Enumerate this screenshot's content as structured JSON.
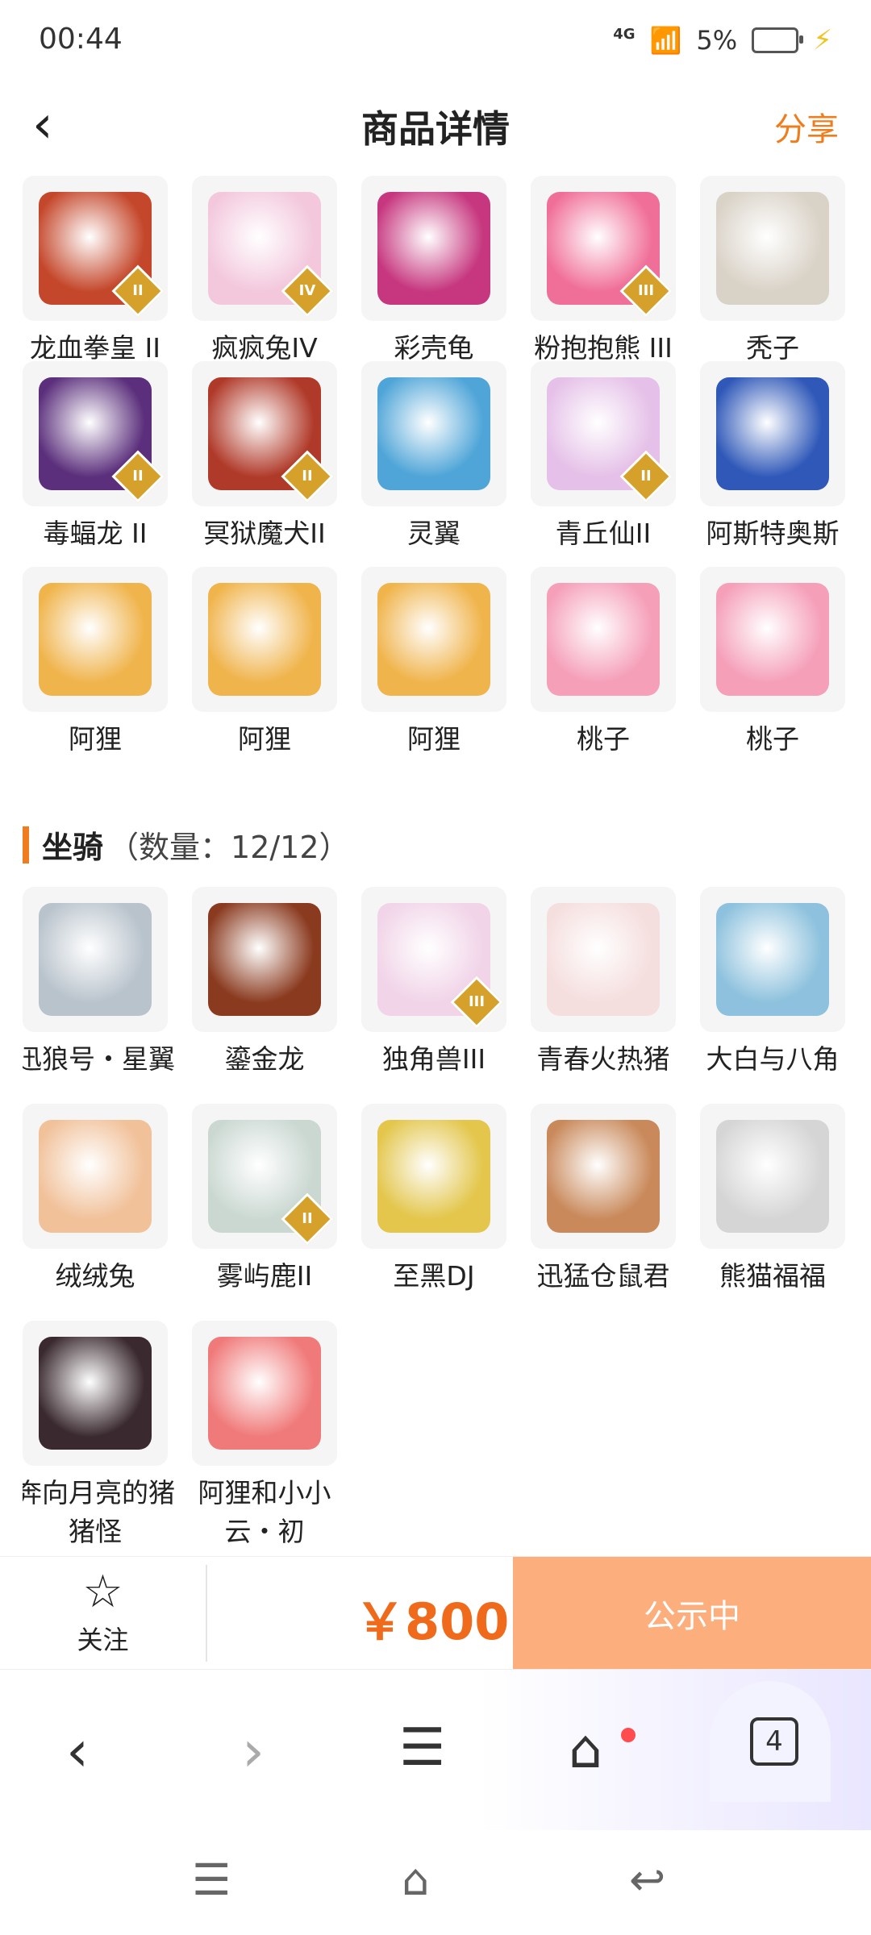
{
  "status": {
    "time": "00:44",
    "signal": "4G",
    "battery": "5%"
  },
  "header": {
    "title": "商品详情",
    "share": "分享"
  },
  "row_top": [
    {
      "label": "龙血拳皇 II",
      "color": "#c4472b",
      "badge": "II"
    },
    {
      "label": "疯疯兔IV",
      "color": "#f3c8dd",
      "badge": "IV"
    },
    {
      "label": "彩壳龟",
      "color": "#c6377f",
      "badge": ""
    },
    {
      "label": "粉抱抱熊 III",
      "color": "#f06f98",
      "badge": "III"
    },
    {
      "label": "秃子",
      "color": "#d9d2c7",
      "badge": ""
    }
  ],
  "row2": [
    {
      "label": "毒蝠龙 II",
      "color": "#5b2f7c",
      "badge": "II"
    },
    {
      "label": "冥狱魔犬II",
      "color": "#b03a2a",
      "badge": "II"
    },
    {
      "label": "灵翼",
      "color": "#4fa5d8",
      "badge": ""
    },
    {
      "label": "青丘仙II",
      "color": "#e5c0e8",
      "badge": "II"
    },
    {
      "label": "阿斯特奥斯",
      "color": "#2f58b8",
      "badge": ""
    }
  ],
  "row3": [
    {
      "label": "阿狸",
      "color": "#f0b44c",
      "badge": ""
    },
    {
      "label": "阿狸",
      "color": "#f0b44c",
      "badge": ""
    },
    {
      "label": "阿狸",
      "color": "#f0b44c",
      "badge": ""
    },
    {
      "label": "桃子",
      "color": "#f59fb9",
      "badge": ""
    },
    {
      "label": "桃子",
      "color": "#f59fb9",
      "badge": ""
    }
  ],
  "section": {
    "name": "坐骑",
    "count": "（数量：12/12）"
  },
  "mounts": [
    {
      "label": "迅狼号・星翼",
      "color": "#b9c3cc",
      "badge": ""
    },
    {
      "label": "鎏金龙",
      "color": "#8a3a1f",
      "badge": ""
    },
    {
      "label": "独角兽III",
      "color": "#f1d4e8",
      "badge": "III"
    },
    {
      "label": "青春火热猪",
      "color": "#f5dede",
      "badge": ""
    },
    {
      "label": "大白与八角",
      "color": "#8dc1dd",
      "badge": ""
    },
    {
      "label": "绒绒兔",
      "color": "#f1c19a",
      "badge": ""
    },
    {
      "label": "雾屿鹿II",
      "color": "#cbd8d2",
      "badge": "II"
    },
    {
      "label": "至黑DJ",
      "color": "#e3c64b",
      "badge": ""
    },
    {
      "label": "迅猛仓鼠君",
      "color": "#c9895b",
      "badge": ""
    },
    {
      "label": "熊猫福福",
      "color": "#d5d5d5",
      "badge": ""
    },
    {
      "label": "奔向月亮的猪猪怪",
      "color": "#3a2a30",
      "badge": ""
    },
    {
      "label": "阿狸和小小云・初",
      "color": "#f07a7a",
      "badge": ""
    }
  ],
  "action": {
    "follow": "关注",
    "price": "￥800",
    "notice": "公示中"
  },
  "browser": {
    "tabs_count": "4"
  }
}
